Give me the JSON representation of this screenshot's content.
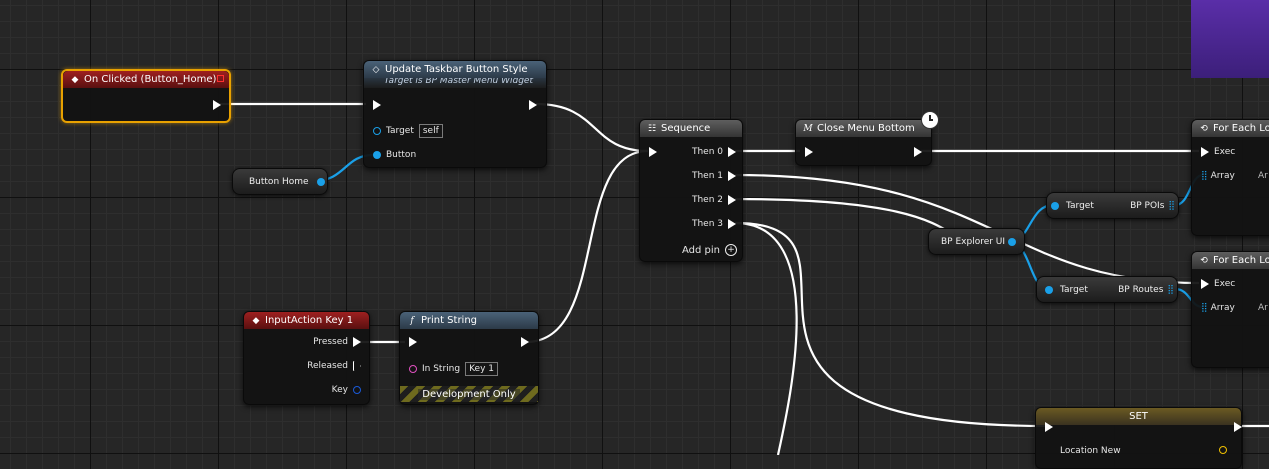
{
  "nodes": {
    "on_clicked": {
      "title": "On Clicked (Button_Home)"
    },
    "update_taskbar": {
      "title": "Update Taskbar Button Style",
      "subtitle": "Target is BP Master Menu Widget",
      "target_label": "Target",
      "target_value": "self",
      "button_label": "Button"
    },
    "button_home": {
      "label": "Button Home"
    },
    "input_action": {
      "title": "InputAction Key 1",
      "pressed": "Pressed",
      "released": "Released",
      "key": "Key"
    },
    "print_string": {
      "title": "Print String",
      "in_string_label": "In String",
      "in_string_value": "Key 1",
      "dev_only": "Development Only"
    },
    "sequence": {
      "title": "Sequence",
      "then0": "Then 0",
      "then1": "Then 1",
      "then2": "Then 2",
      "then3": "Then 3",
      "add_pin": "Add pin"
    },
    "close_menu": {
      "title": "Close Menu Bottom"
    },
    "foreach1": {
      "title": "For Each Lo",
      "exec": "Exec",
      "array": "Array",
      "ar": "Ar"
    },
    "foreach2": {
      "title": "For Each Lo",
      "exec": "Exec",
      "array": "Array",
      "ar": "Ar"
    },
    "target_pois": {
      "target": "Target",
      "value": "BP POIs"
    },
    "target_routes": {
      "target": "Target",
      "value": "BP Routes"
    },
    "bp_explorer": {
      "label": "BP Explorer UI"
    },
    "set": {
      "title": "SET",
      "location_new": "Location New"
    }
  },
  "icons": {
    "event": "diamond-icon",
    "function": "function-icon",
    "macro": "macro-icon",
    "sequence": "sequence-icon",
    "loop": "loop-icon",
    "latent": "clock-icon"
  },
  "colors": {
    "event_header": "#9e2020",
    "function_header": "#4a6278",
    "object_pin": "#1aa0e8",
    "string_pin": "#e050c0",
    "selection": "#e8a100",
    "comment_box": "#5a2ea8"
  }
}
